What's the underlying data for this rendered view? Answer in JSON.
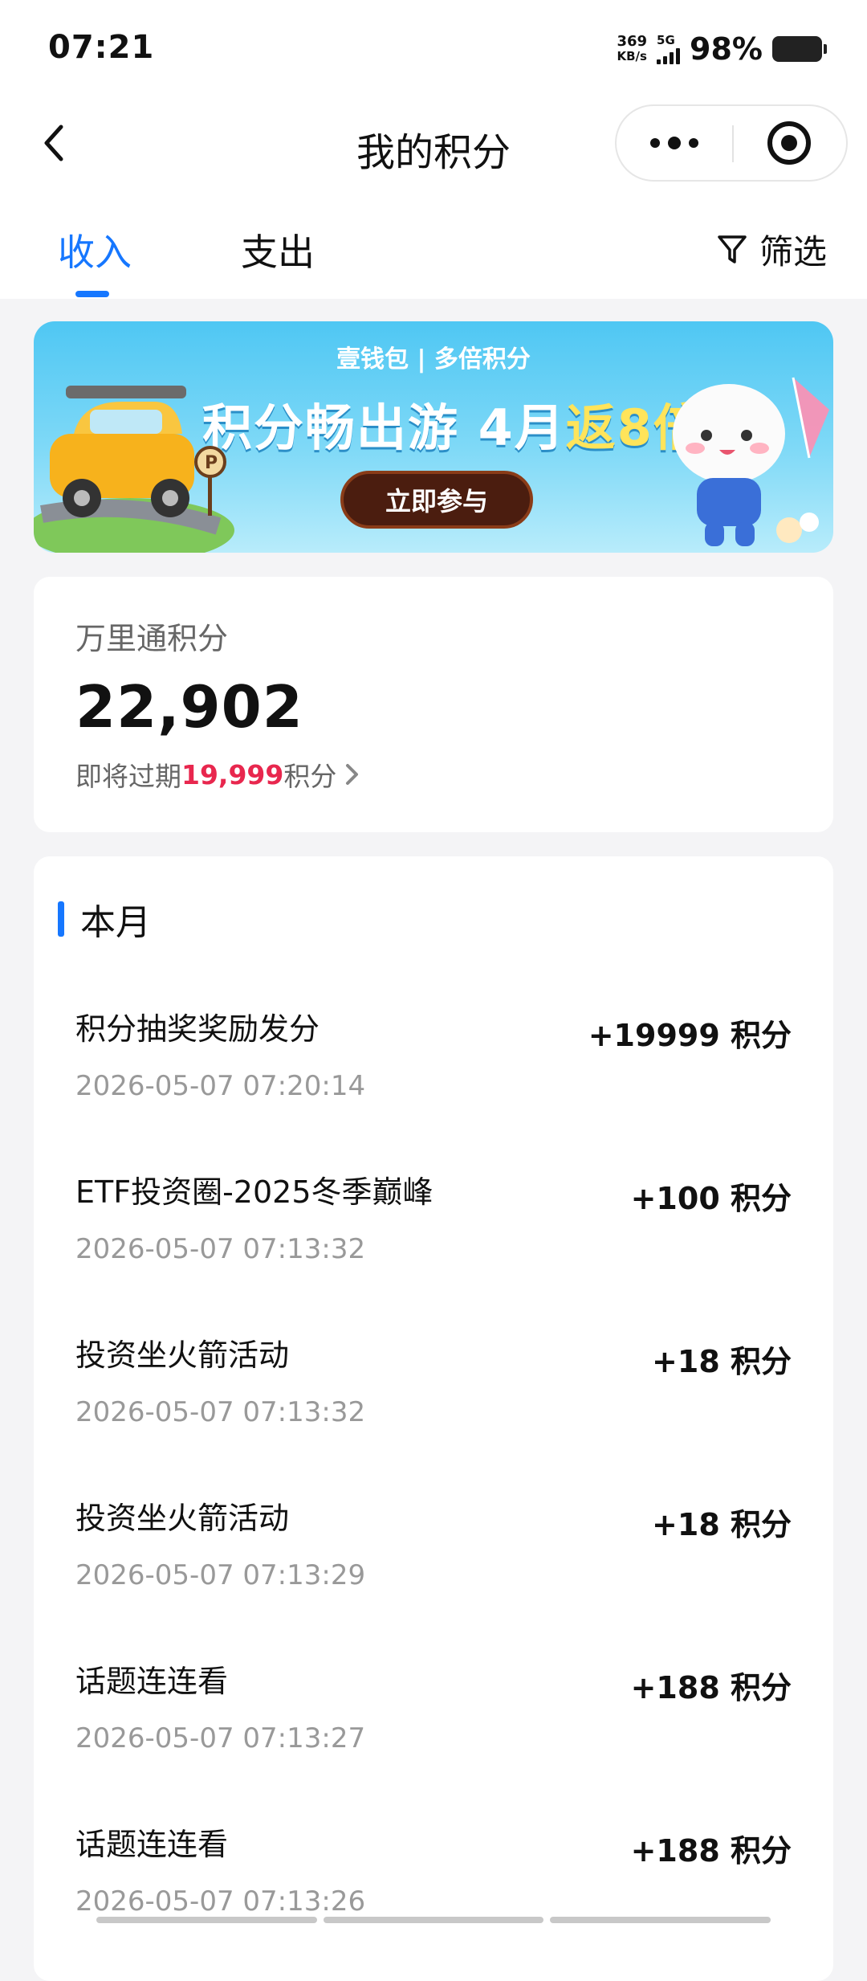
{
  "status_bar": {
    "time": "07:21",
    "net_speed": "369",
    "net_speed_unit": "KB/s",
    "network": "5G",
    "battery": "98%"
  },
  "nav": {
    "title": "我的积分"
  },
  "tabs": {
    "items": [
      {
        "label": "收入",
        "active": true
      },
      {
        "label": "支出",
        "active": false
      }
    ],
    "filter_label": "筛选"
  },
  "banner": {
    "brand": "壹钱包 | 多倍积分",
    "headline_main": "积分畅出游 4月",
    "headline_highlight": "返8倍",
    "cta": "立即参与"
  },
  "points": {
    "label": "万里通积分",
    "total": "22,902",
    "expire_prefix": "即将过期",
    "expire_amount": "19,999",
    "expire_suffix": "积分"
  },
  "records": {
    "section_title": "本月",
    "items": [
      {
        "desc": "积分抽奖奖励发分",
        "time": "2026-05-07 07:20:14",
        "amount": "+19999 积分"
      },
      {
        "desc": "ETF投资圈-2025冬季巅峰",
        "time": "2026-05-07 07:13:32",
        "amount": "+100 积分"
      },
      {
        "desc": "投资坐火箭活动",
        "time": "2026-05-07 07:13:32",
        "amount": "+18 积分"
      },
      {
        "desc": "投资坐火箭活动",
        "time": "2026-05-07 07:13:29",
        "amount": "+18 积分"
      },
      {
        "desc": "话题连连看",
        "time": "2026-05-07 07:13:27",
        "amount": "+188 积分"
      },
      {
        "desc": "话题连连看",
        "time": "2026-05-07 07:13:26",
        "amount": "+188 积分"
      }
    ]
  },
  "colors": {
    "accent": "#1677ff",
    "expire_highlight": "#e8274e",
    "banner_button": "#4b1d0f"
  },
  "icons": {
    "back": "chevron-left-icon",
    "more": "more-dots-icon",
    "close": "target-close-icon",
    "filter": "funnel-icon",
    "expire_arrow": "chevron-right-icon"
  }
}
